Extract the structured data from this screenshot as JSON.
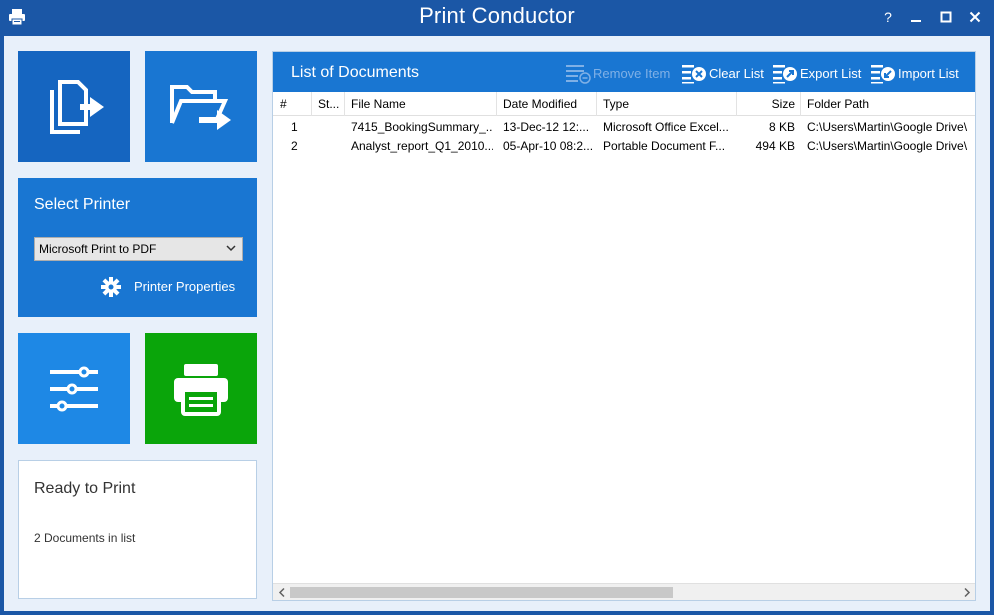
{
  "window": {
    "title": "Print Conductor",
    "help_label": "?"
  },
  "sidebar": {
    "select_printer_label": "Select Printer",
    "printer_selected": "Microsoft Print to PDF",
    "printer_properties_label": "Printer Properties",
    "status_title": "Ready to Print",
    "status_count": "2 Documents in list"
  },
  "documents": {
    "title": "List of Documents",
    "toolbar": {
      "remove_item": "Remove Item",
      "clear_list": "Clear List",
      "export_list": "Export List",
      "import_list": "Import List"
    },
    "columns": [
      "#",
      "St...",
      "File Name",
      "Date Modified",
      "Type",
      "Size",
      "Folder Path"
    ],
    "rows": [
      [
        "1",
        "",
        "7415_BookingSummary_...",
        "13-Dec-12 12:...",
        "Microsoft Office Excel...",
        "8 KB",
        "C:\\Users\\Martin\\Google Drive\\"
      ],
      [
        "2",
        "",
        "Analyst_report_Q1_2010....",
        "05-Apr-10 08:2...",
        "Portable Document F...",
        "494 KB",
        "C:\\Users\\Martin\\Google Drive\\"
      ]
    ]
  },
  "colors": {
    "titlebar": "#1b57a6",
    "tile_blue": "#1976d2",
    "tile_print": "#0aa50a"
  }
}
